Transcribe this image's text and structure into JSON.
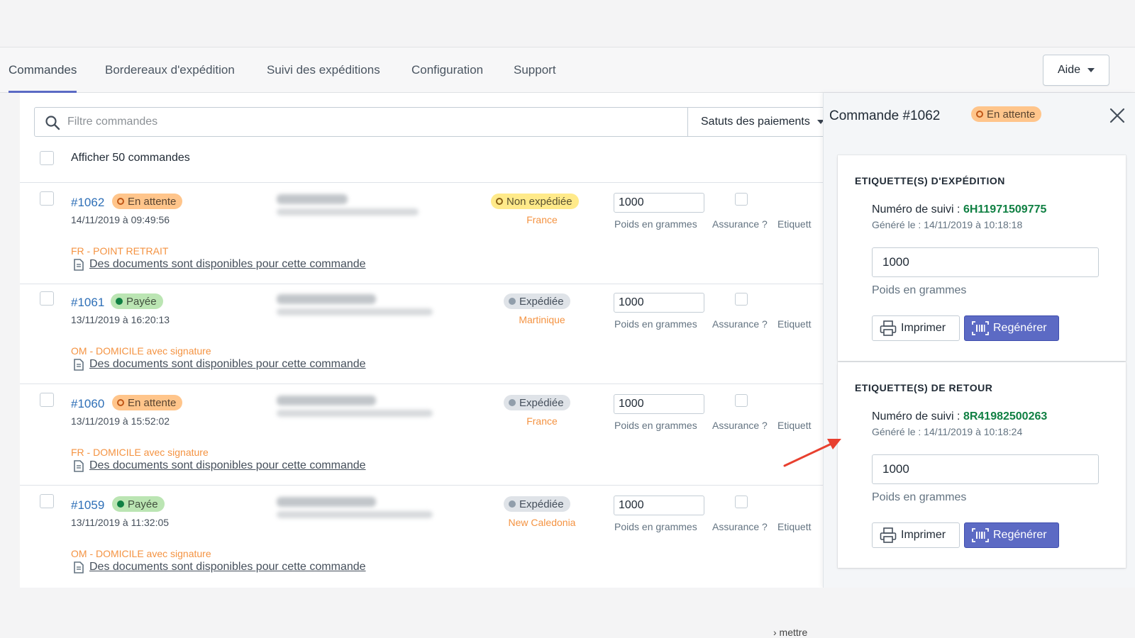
{
  "nav": {
    "tabs": [
      {
        "label": "Commandes"
      },
      {
        "label": "Bordereaux d'expédition"
      },
      {
        "label": "Suivi des expéditions"
      },
      {
        "label": "Configuration"
      },
      {
        "label": "Support"
      }
    ],
    "help_label": "Aide"
  },
  "filters": {
    "search_placeholder": "Filtre commandes",
    "payment_status_label": "Satuts des paiements",
    "show_label": "Afficher 50 commandes"
  },
  "columns": {
    "weight_label": "Poids en grammes",
    "insurance_label": "Assurance ?",
    "label_col": "Etiquett"
  },
  "orders": [
    {
      "id": "#1062",
      "payment": "En attente",
      "date": "14/11/2019 à 09:49:56",
      "shipping": "Non expédiée",
      "country": "France",
      "weight": "1000",
      "service": "FR - POINT RETRAIT",
      "docs": "Des documents sont disponibles pour cette commande"
    },
    {
      "id": "#1061",
      "payment": "Payée",
      "date": "13/11/2019 à 16:20:13",
      "shipping": "Expédiée",
      "country": "Martinique",
      "weight": "1000",
      "service": "OM - DOMICILE avec signature",
      "docs": "Des documents sont disponibles pour cette commande"
    },
    {
      "id": "#1060",
      "payment": "En attente",
      "date": "13/11/2019 à 15:52:02",
      "shipping": "Expédiée",
      "country": "France",
      "weight": "1000",
      "service": "FR - DOMICILE avec signature",
      "docs": "Des documents sont disponibles pour cette commande"
    },
    {
      "id": "#1059",
      "payment": "Payée",
      "date": "13/11/2019 à 11:32:05",
      "shipping": "Expédiée",
      "country": "New Caledonia",
      "weight": "1000",
      "service": "OM - DOMICILE avec signature",
      "docs": "Des documents sont disponibles pour cette commande"
    }
  ],
  "panel": {
    "title": "Commande #1062",
    "status": "En attente",
    "shipping_card": {
      "title": "ETIQUETTE(S) D'EXPÉDITION",
      "tracking_label": "Numéro de suivi : ",
      "tracking_number": "6H11971509775",
      "generated": "Généré le : 14/11/2019 à 10:18:18",
      "weight": "1000",
      "weight_label": "Poids en grammes",
      "print_label": "Imprimer",
      "regen_label": "Regénérer"
    },
    "return_card": {
      "title": "ETIQUETTE(S) DE RETOUR",
      "tracking_label": "Numéro de suivi : ",
      "tracking_number": "8R41982500263",
      "generated": "Généré le : 14/11/2019 à 10:18:24",
      "weight": "1000",
      "weight_label": "Poids en grammes",
      "print_label": "Imprimer",
      "regen_label": "Regénérer"
    }
  },
  "footer_fragment": "› mettre",
  "colors": {
    "accent": "#5c6ac4",
    "link": "#2e6fb7",
    "tracking": "#108043",
    "orange": "#f49342",
    "arrow": "#e8402f"
  }
}
